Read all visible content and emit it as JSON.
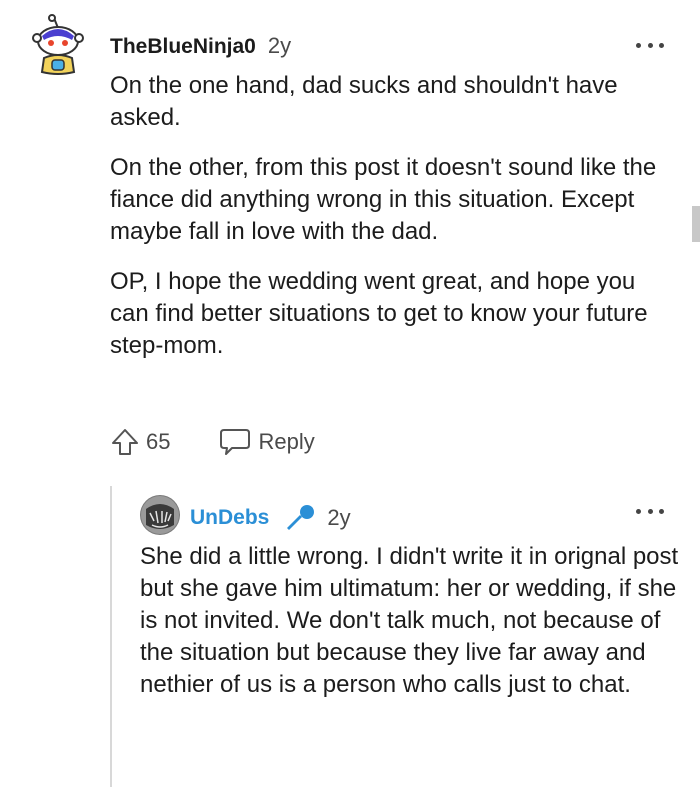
{
  "comment1": {
    "author": "TheBlueNinja0",
    "age": "2y",
    "paragraphs": [
      "On the one hand, dad sucks and shouldn't have asked.",
      "On the other, from this post it doesn't sound like the fiance did anything wrong in this situation. Except maybe fall in love with the dad.",
      "OP, I hope the wedding went great, and hope you can find better situations to get to know your future step-mom."
    ],
    "score": "65",
    "reply_label": "Reply",
    "icons": {
      "avatar": "snoo-avatar-icon",
      "upvote": "upvote-arrow-icon",
      "reply": "speech-bubble-icon",
      "more": "more-dots-icon"
    }
  },
  "comment2": {
    "author": "UnDebs",
    "age": "2y",
    "text": "She did a little wrong. I didn't write it in orignal post but she gave him ultimatum: her or wedding, if she is not invited. We don't talk much, not because of the situation but because they live far away and nethier of us is a person who calls just to chat.",
    "icons": {
      "avatar": "user-avatar-icon",
      "flair": "microphone-icon",
      "more": "more-dots-icon"
    }
  },
  "colors": {
    "text": "#1c1c1c",
    "muted": "#4a4a4a",
    "username_link": "#2b8fd6",
    "thread_line": "#d8d8d8"
  }
}
